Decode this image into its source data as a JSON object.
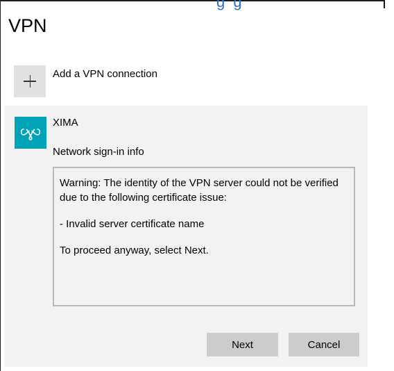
{
  "header": {
    "link_fragment": "g  g",
    "title": "VPN"
  },
  "add_connection": {
    "label": "Add a VPN connection",
    "icon": "plus-icon"
  },
  "connection": {
    "name": "XIMA",
    "icon": "vpn-link-icon",
    "icon_color": "#00a3b6",
    "signin_label": "Network sign-in info",
    "message": {
      "line1": "Warning: The identity of the VPN server could not be verified due to the following certificate issue:",
      "line2": "- Invalid server certificate name",
      "line3": "To proceed anyway, select Next."
    },
    "next_label": "Next",
    "cancel_label": "Cancel"
  }
}
